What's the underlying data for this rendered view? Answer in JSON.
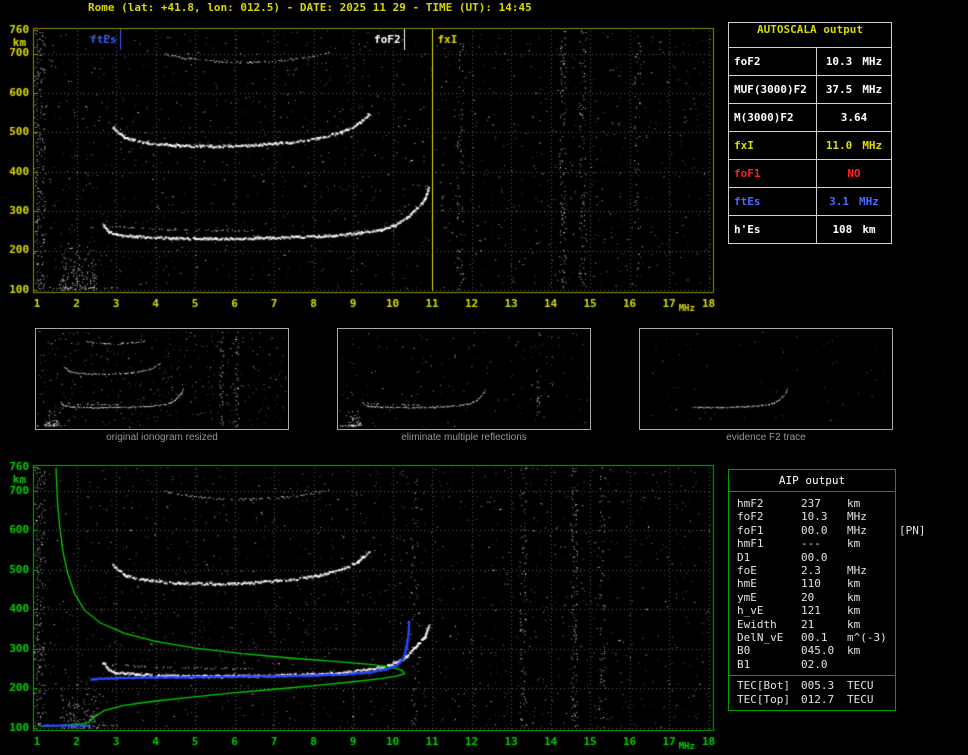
{
  "header": {
    "title": "Rome (lat: +41.8, lon: 012.5) - DATE: 2025 11 29 - TIME (UT): 14:45"
  },
  "colors": {
    "top_axis": "#8a8a00",
    "top_ticks": "#dcdc00",
    "title_yellow": "#d8d800",
    "bottom_axis": "#00b400",
    "bottom_ticks": "#00d000",
    "profile_green": "#00cc00",
    "restored_blue": "#2a48ff",
    "red": "#ff2222",
    "blue": "#4a6aff",
    "white": "#ffffff",
    "caption_gray": "#969696"
  },
  "autoscala": {
    "title": "AUTOSCALA output",
    "rows": [
      {
        "label": "foF2",
        "value": "10.3",
        "unit": "MHz",
        "color": "#ffffff"
      },
      {
        "label": "MUF(3000)F2",
        "value": "37.5",
        "unit": "MHz",
        "color": "#ffffff"
      },
      {
        "label": "M(3000)F2",
        "value": "3.64",
        "unit": "",
        "color": "#ffffff"
      },
      {
        "label": "fxI",
        "value": "11.0",
        "unit": "MHz",
        "color": "#dcdc00"
      },
      {
        "label": "foF1",
        "value": "NO",
        "unit": "",
        "color": "#ff2222"
      },
      {
        "label": "ftEs",
        "value": "3.1",
        "unit": "MHz",
        "color": "#4a6aff"
      },
      {
        "label": "h'Es",
        "value": "108",
        "unit": "km",
        "color": "#ffffff"
      }
    ]
  },
  "aip": {
    "title": "AIP output",
    "rows": [
      {
        "label": "hmF2",
        "value": "237",
        "unit": "km",
        "extra": ""
      },
      {
        "label": "foF2",
        "value": "10.3",
        "unit": "MHz",
        "extra": ""
      },
      {
        "label": "foF1",
        "value": "00.0",
        "unit": "MHz",
        "extra": "[PN]"
      },
      {
        "label": "hmF1",
        "value": "---",
        "unit": "km",
        "extra": ""
      },
      {
        "label": "D1",
        "value": "00.0",
        "unit": "",
        "extra": ""
      },
      {
        "label": "foE",
        "value": "2.3",
        "unit": "MHz",
        "extra": ""
      },
      {
        "label": "hmE",
        "value": "110",
        "unit": "km",
        "extra": ""
      },
      {
        "label": "ymE",
        "value": "20",
        "unit": "km",
        "extra": ""
      },
      {
        "label": "h_vE",
        "value": "121",
        "unit": "km",
        "extra": ""
      },
      {
        "label": "Ewidth",
        "value": "21",
        "unit": "km",
        "extra": ""
      },
      {
        "label": "DelN_vE",
        "value": "00.1",
        "unit": "m^(-3)",
        "extra": ""
      },
      {
        "label": "B0",
        "value": "045.0",
        "unit": "km",
        "extra": ""
      },
      {
        "label": "B1",
        "value": "02.0",
        "unit": "",
        "extra": ""
      }
    ],
    "tec_rows": [
      {
        "label": "TEC[Bot]",
        "value": "005.3",
        "unit": "TECU",
        "extra": ""
      },
      {
        "label": "TEC[Top]",
        "value": "012.7",
        "unit": "TECU",
        "extra": ""
      }
    ]
  },
  "thumbnails": [
    {
      "caption": "original ionogram resized",
      "traces": [
        "Es",
        "F2-hop1",
        "F2-hop1x",
        "F2-hop2",
        "F2-hop3"
      ],
      "blob": true,
      "noise": 420,
      "seed": 31,
      "columns": [
        {
          "x": 13.5,
          "n": 45
        },
        {
          "x": 14.5,
          "n": 40
        }
      ]
    },
    {
      "caption": "eliminate multiple reflections",
      "traces": [
        "Es",
        "F2-hop1",
        "F2-hop1x"
      ],
      "blob": true,
      "noise": 150,
      "seed": 32,
      "columns": [
        {
          "x": 14.5,
          "n": 25
        }
      ]
    },
    {
      "caption": "evidence F2 trace",
      "traces": [
        "F2-hop1"
      ],
      "fmin": 4.0,
      "blob": false,
      "noise": 55,
      "seed": 33,
      "columns": []
    }
  ],
  "chart_data": [
    {
      "type": "scatter",
      "title": "recorded ionogram (virtual height vs frequency)",
      "xlabel": "MHz",
      "ylabel": "km",
      "xlim": [
        1,
        18
      ],
      "ylim": [
        100,
        760
      ],
      "x_ticks": [
        1,
        2,
        3,
        4,
        5,
        6,
        7,
        8,
        9,
        10,
        11,
        12,
        13,
        14,
        15,
        16,
        17,
        18
      ],
      "y_ticks": [
        760,
        700,
        600,
        500,
        400,
        300,
        200,
        100
      ],
      "grid": true,
      "axis_color": "#8a8a00",
      "tick_color": "#dcdc00",
      "markers": [
        {
          "label": "ftEs",
          "x": 3.1,
          "color": "#3a5cff",
          "line": "short",
          "label_side": "left"
        },
        {
          "label": "foF2",
          "x": 10.3,
          "color": "#ffffff",
          "line": "short",
          "label_side": "left"
        },
        {
          "label": "fxI",
          "x": 11.0,
          "color": "#dcdc00",
          "line": "full",
          "label_side": "right"
        }
      ],
      "traces": [
        {
          "name": "Es",
          "color": "#ffffff",
          "px": 1,
          "density": 0.3,
          "jitter": 1.5,
          "points": [
            [
              1.05,
              107
            ],
            [
              1.5,
              106
            ],
            [
              2.3,
              106
            ],
            [
              3.05,
              108
            ]
          ]
        },
        {
          "name": "F2-hop1",
          "color": "#ffffff",
          "px": 2,
          "density": 0.95,
          "jitter": 2.2,
          "points": [
            [
              2.65,
              268
            ],
            [
              2.8,
              250
            ],
            [
              3.0,
              242
            ],
            [
              3.5,
              237
            ],
            [
              4.5,
              233
            ],
            [
              5.5,
              232
            ],
            [
              6.5,
              233
            ],
            [
              7.5,
              236
            ],
            [
              8.5,
              240
            ],
            [
              9.2,
              247
            ],
            [
              9.7,
              255
            ],
            [
              10.05,
              266
            ],
            [
              10.35,
              284
            ],
            [
              10.6,
              310
            ],
            [
              10.8,
              332
            ],
            [
              10.9,
              360
            ]
          ]
        },
        {
          "name": "F2-hop1x",
          "color": "#ffffff",
          "px": 1,
          "density": 0.45,
          "jitter": 1.8,
          "points": [
            [
              2.9,
              262
            ],
            [
              3.5,
              257
            ],
            [
              4.5,
              254
            ],
            [
              5.5,
              252
            ],
            [
              6.5,
              251
            ]
          ]
        },
        {
          "name": "F2-hop2",
          "color": "#ffffff",
          "px": 2,
          "density": 0.85,
          "jitter": 2.2,
          "points": [
            [
              2.9,
              515
            ],
            [
              3.2,
              488
            ],
            [
              3.8,
              474
            ],
            [
              4.6,
              468
            ],
            [
              5.6,
              466
            ],
            [
              6.6,
              470
            ],
            [
              7.4,
              477
            ],
            [
              8.1,
              487
            ],
            [
              8.7,
              502
            ],
            [
              9.1,
              522
            ],
            [
              9.4,
              548
            ]
          ]
        },
        {
          "name": "F2-hop3",
          "color": "#ffffff",
          "px": 1,
          "density": 0.6,
          "jitter": 2.0,
          "points": [
            [
              4.2,
              700
            ],
            [
              4.8,
              688
            ],
            [
              5.6,
              681
            ],
            [
              6.4,
              679
            ],
            [
              7.2,
              684
            ],
            [
              7.9,
              692
            ],
            [
              8.4,
              703
            ]
          ]
        }
      ],
      "noise": {
        "seed": 7,
        "uniform": 1500,
        "left_band": 220,
        "columns": [
          {
            "x": 11.7,
            "n": 80
          },
          {
            "x": 14.3,
            "n": 140
          },
          {
            "x": 14.8,
            "n": 110
          },
          {
            "x": 16.2,
            "n": 55
          }
        ],
        "blob": {
          "f": [
            1.6,
            2.5
          ],
          "h": [
            100,
            235
          ],
          "n": 170
        }
      }
    },
    {
      "type": "scatter",
      "title": "ionogram with AIP profile and restored trace",
      "xlabel": "MHz",
      "ylabel": "km",
      "xlim": [
        1,
        18
      ],
      "ylim": [
        100,
        760
      ],
      "x_ticks": [
        1,
        2,
        3,
        4,
        5,
        6,
        7,
        8,
        9,
        10,
        11,
        12,
        13,
        14,
        15,
        16,
        17,
        18
      ],
      "y_ticks": [
        760,
        700,
        600,
        500,
        400,
        300,
        200,
        100
      ],
      "grid": true,
      "axis_color": "#00b400",
      "tick_color": "#00d000",
      "markers": [],
      "traces_same_as": 0,
      "profile": {
        "name": "electron density profile (plasma frequency vs height)",
        "color": "#00cc00",
        "points": [
          [
            1.1,
            104
          ],
          [
            1.6,
            106
          ],
          [
            2.1,
            109
          ],
          [
            2.3,
            114
          ],
          [
            2.45,
            128
          ],
          [
            2.7,
            144
          ],
          [
            3.2,
            157
          ],
          [
            3.9,
            167
          ],
          [
            4.8,
            177
          ],
          [
            5.9,
            188
          ],
          [
            7.0,
            198
          ],
          [
            8.1,
            208
          ],
          [
            9.0,
            217
          ],
          [
            9.7,
            225
          ],
          [
            10.1,
            231
          ],
          [
            10.3,
            237
          ],
          [
            10.25,
            245
          ],
          [
            10.05,
            252
          ],
          [
            9.5,
            260
          ],
          [
            8.6,
            268
          ],
          [
            7.4,
            277
          ],
          [
            6.2,
            288
          ],
          [
            5.0,
            302
          ],
          [
            4.0,
            319
          ],
          [
            3.2,
            340
          ],
          [
            2.6,
            366
          ],
          [
            2.2,
            398
          ],
          [
            1.95,
            440
          ],
          [
            1.78,
            490
          ],
          [
            1.66,
            545
          ],
          [
            1.58,
            605
          ],
          [
            1.52,
            670
          ],
          [
            1.48,
            758
          ]
        ]
      },
      "restored_trace": {
        "name": "autoscaled F2 trace",
        "color": "#2a48ff",
        "px": 2,
        "density": 1.0,
        "jitter": 0.8,
        "points": [
          [
            2.35,
            225
          ],
          [
            2.6,
            227
          ],
          [
            3.2,
            229
          ],
          [
            4.0,
            230
          ],
          [
            5.0,
            231
          ],
          [
            6.0,
            232
          ],
          [
            7.0,
            233
          ],
          [
            8.0,
            235
          ],
          [
            8.8,
            238
          ],
          [
            9.4,
            243
          ],
          [
            9.8,
            250
          ],
          [
            10.1,
            261
          ],
          [
            10.25,
            278
          ],
          [
            10.33,
            305
          ],
          [
            10.38,
            340
          ],
          [
            10.4,
            372
          ]
        ]
      },
      "restored_es": {
        "name": "autoscaled Es trace",
        "color": "#2a48ff",
        "px": 2,
        "density": 0.75,
        "jitter": 0.8,
        "points": [
          [
            1.15,
            108
          ],
          [
            1.6,
            109
          ],
          [
            2.0,
            108
          ],
          [
            2.3,
            109
          ]
        ]
      },
      "noise": {
        "seed": 21,
        "uniform": 1600,
        "left_band": 200,
        "columns": [
          {
            "x": 10.55,
            "n": 50
          },
          {
            "x": 13.3,
            "n": 110
          },
          {
            "x": 14.6,
            "n": 130
          },
          {
            "x": 15.3,
            "n": 70
          }
        ],
        "blob": {
          "f": [
            1.6,
            2.5
          ],
          "h": [
            100,
            235
          ],
          "n": 160
        }
      }
    }
  ]
}
